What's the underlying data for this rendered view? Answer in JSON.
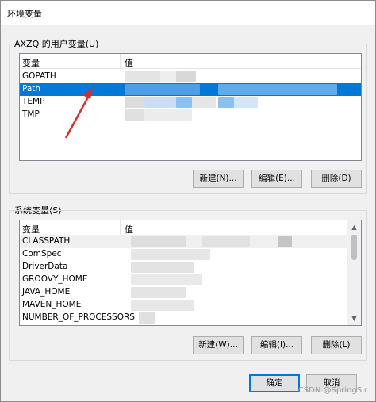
{
  "window": {
    "title": "环境变量"
  },
  "user_vars": {
    "group_label": "AXZQ 的用户变量(U)",
    "columns": [
      "变量",
      "值"
    ],
    "rows": [
      {
        "name": "GOPATH",
        "selected": false
      },
      {
        "name": "Path",
        "selected": true
      },
      {
        "name": "TEMP",
        "selected": false
      },
      {
        "name": "TMP",
        "selected": false
      }
    ],
    "buttons": {
      "new": "新建(N)...",
      "edit": "编辑(E)...",
      "delete": "删除(D)"
    }
  },
  "system_vars": {
    "group_label": "系统变量(S)",
    "columns": [
      "变量",
      "值"
    ],
    "rows": [
      {
        "name": "CLASSPATH"
      },
      {
        "name": "ComSpec"
      },
      {
        "name": "DriverData"
      },
      {
        "name": "GROOVY_HOME"
      },
      {
        "name": "JAVA_HOME"
      },
      {
        "name": "MAVEN_HOME"
      },
      {
        "name": "NUMBER_OF_PROCESSORS"
      }
    ],
    "buttons": {
      "new": "新建(W)...",
      "edit": "编辑(I)...",
      "delete": "删除(L)"
    }
  },
  "dialog_buttons": {
    "ok": "确定",
    "cancel": "取消"
  },
  "watermark": "CSDN @SpringSir",
  "colors": {
    "selection": "#0078d7",
    "annotation_arrow": "#d32f2f"
  },
  "icons": {
    "scroll_up": "chevron-up-icon",
    "scroll_down": "chevron-down-icon"
  }
}
